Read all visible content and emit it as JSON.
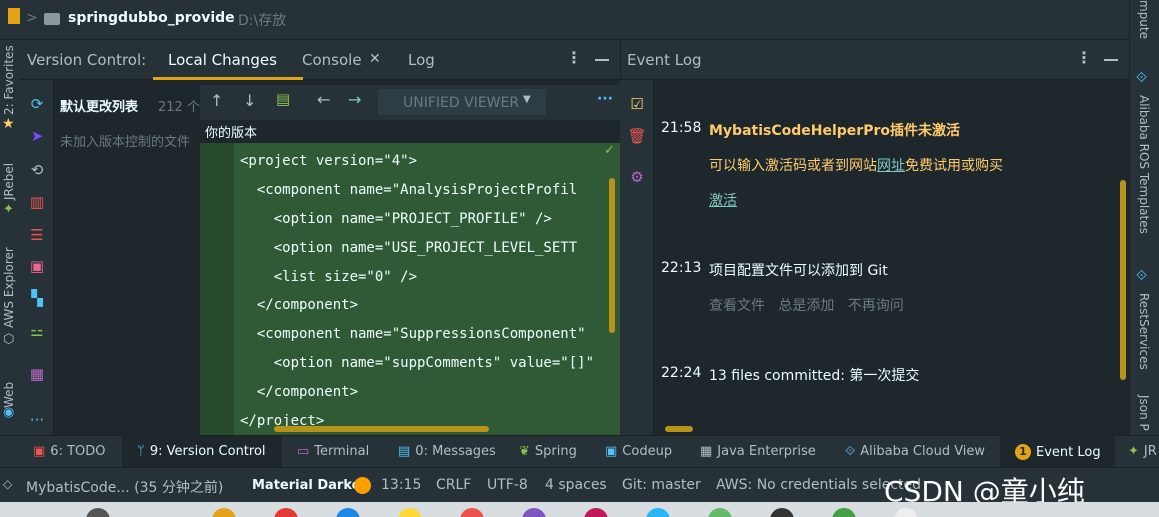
{
  "breadcrumb": {
    "project": "springdubbo_provide",
    "path": "D:\\存放"
  },
  "vcs": {
    "title": "Version Control:",
    "tabs": [
      "Local Changes",
      "Console",
      "Log"
    ],
    "changelist_name": "默认更改列表",
    "changelist_count": "212 个",
    "unversioned": "未加入版本控制的文件",
    "viewer_mode": "UNIFIED VIEWER",
    "your_version": "你的版本",
    "code_lines": [
      "<project version=\"4\">",
      "  <component name=\"AnalysisProjectProfil",
      "    <option name=\"PROJECT_PROFILE\" />",
      "    <option name=\"USE_PROJECT_LEVEL_SETT",
      "    <list size=\"0\" />",
      "  </component>",
      "  <component name=\"SuppressionsComponent\"",
      "    <option name=\"suppComments\" value=\"[]\"",
      "  </component>",
      "</project>"
    ]
  },
  "event_log": {
    "title": "Event Log",
    "entries": [
      {
        "time": "21:58",
        "title": "MybatisCodeHelperPro插件未激活",
        "line1_a": "可以输入激活码或者到网站",
        "line1_link": "网址",
        "line1_b": "免费试用或购买",
        "link2": "激活"
      },
      {
        "time": "22:13",
        "title": "项目配置文件可以添加到 Git",
        "actions": "查看文件   总是添加   不再询问"
      },
      {
        "time": "22:24",
        "title": "13 files committed: 第一次提交"
      }
    ]
  },
  "left_stripe": {
    "favorites": "2: Favorites",
    "jrebel": "JRebel",
    "aws": "AWS Explorer",
    "web": "Web"
  },
  "right_stripe": {
    "compute": "mpute",
    "alibaba": "Alibaba ROS Templates",
    "rest": "RestServices",
    "json": "Json P"
  },
  "tool_windows": [
    {
      "label": "6: TODO",
      "icon": "todo-icon"
    },
    {
      "label": "9: Version Control",
      "icon": "branch-icon"
    },
    {
      "label": "Terminal",
      "icon": "terminal-icon"
    },
    {
      "label": "0: Messages",
      "icon": "messages-icon"
    },
    {
      "label": "Spring",
      "icon": "spring-icon"
    },
    {
      "label": "Codeup",
      "icon": "codeup-icon"
    },
    {
      "label": "Java Enterprise",
      "icon": "java-icon"
    },
    {
      "label": "Alibaba Cloud View",
      "icon": "cloud-icon"
    },
    {
      "label": "Event Log",
      "icon": "event-log-icon",
      "badge": "1"
    },
    {
      "label": "JR",
      "icon": "jrebel-icon"
    }
  ],
  "status": {
    "message": "MybatisCode... (35 分钟之前)",
    "theme": "Material Darker",
    "position": "13:15",
    "line_sep": "CRLF",
    "encoding": "UTF-8",
    "indent": "4 spaces",
    "git": "Git: master",
    "aws": "AWS: No credentials selected"
  },
  "watermark": "CSDN @童小纯",
  "colors": {
    "accent": "#e3a21a",
    "link": "#80cbc4",
    "warning": "#ffcb6b",
    "bg": "#263238"
  }
}
